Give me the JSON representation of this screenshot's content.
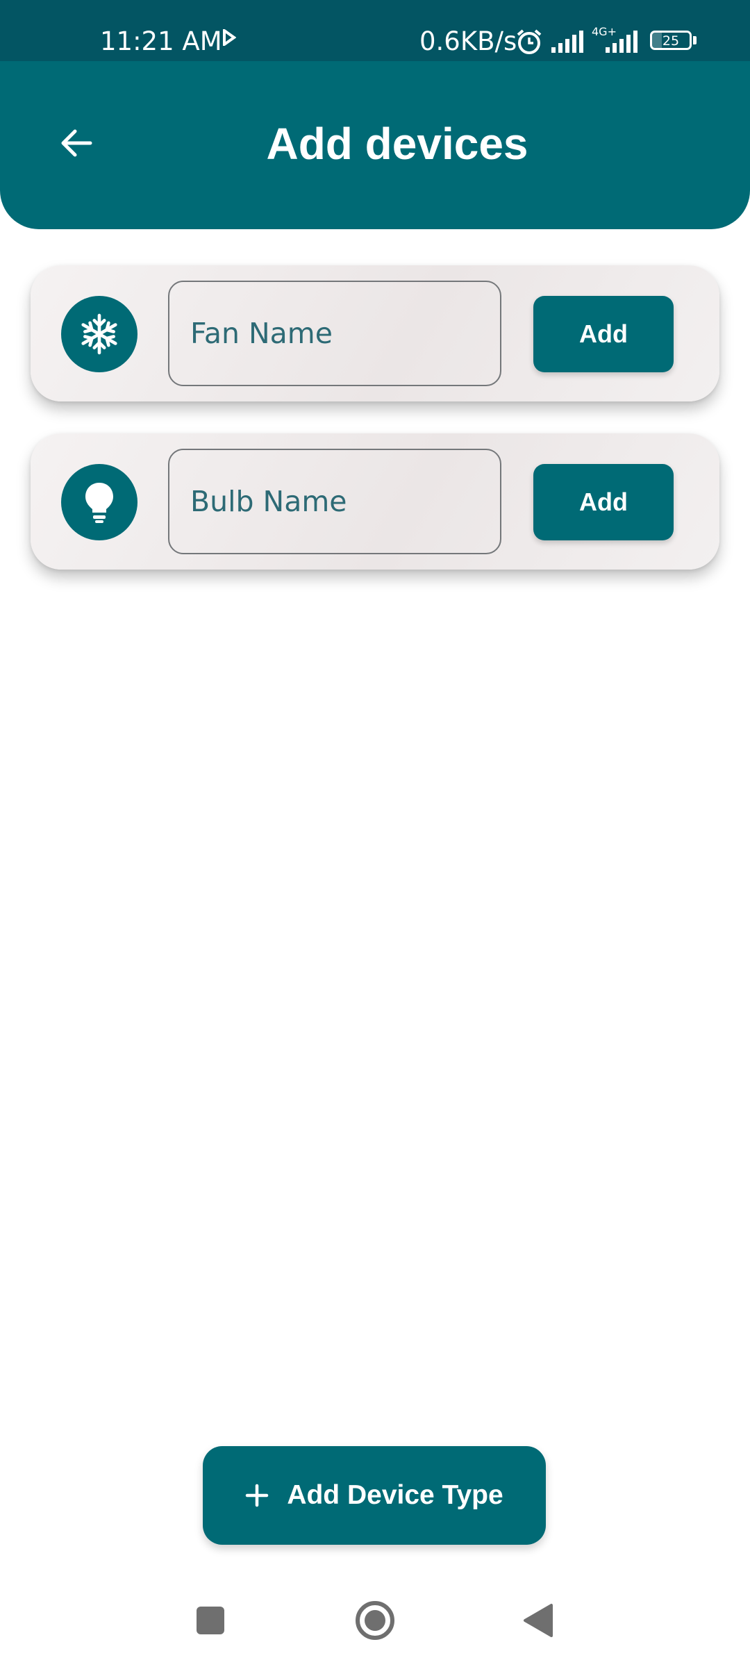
{
  "status_bar": {
    "time": "11:21 AM",
    "network_speed": "0.6KB/s",
    "network_type": "4G+",
    "battery_percent": "25",
    "battery_level": 0.25,
    "icons": [
      "play-icon",
      "alarm-icon",
      "signal-icon",
      "signal-icon",
      "battery-icon"
    ]
  },
  "app_bar": {
    "title": "Add devices",
    "back_icon": "arrow-back-icon"
  },
  "devices": [
    {
      "icon": "snowflake-icon",
      "placeholder": "Fan Name",
      "value": "",
      "button": "Add"
    },
    {
      "icon": "lightbulb-icon",
      "placeholder": "Bulb Name",
      "value": "",
      "button": "Add"
    }
  ],
  "fab": {
    "label": "Add Device Type",
    "icon": "plus-icon"
  },
  "nav_bar": {
    "items": [
      "recents-square-icon",
      "home-circle-icon",
      "back-triangle-icon"
    ]
  },
  "colors": {
    "primary": "#006a75",
    "status_bar": "#035563",
    "card": "#f2efef",
    "field_text": "#13616a",
    "nav_icon": "#6f6f6f"
  }
}
